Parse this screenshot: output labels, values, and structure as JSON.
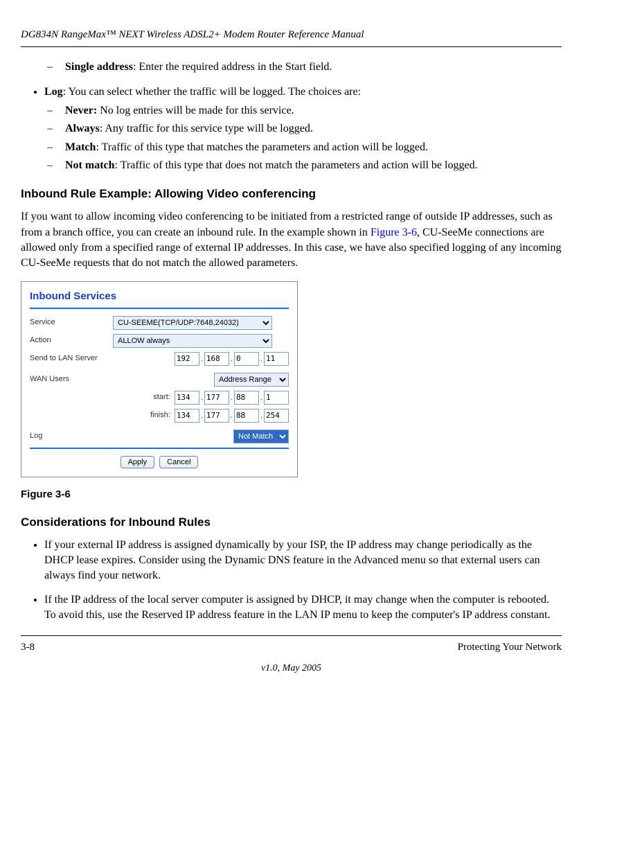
{
  "header": {
    "title": "DG834N RangeMax™ NEXT Wireless ADSL2+ Modem Router Reference Manual"
  },
  "content": {
    "single_address_line": {
      "label": "Single address",
      "text": ": Enter the required address in the Start field."
    },
    "log_intro": {
      "label": "Log",
      "text": ": You can select whether the traffic will be logged. The choices are:"
    },
    "log_items": [
      {
        "label": "Never:",
        "text": " No log entries will be made for this service."
      },
      {
        "label": "Always",
        "text": ": Any traffic for this service type will be logged."
      },
      {
        "label": "Match",
        "text": ": Traffic of this type that matches the parameters and action will be logged."
      },
      {
        "label": "Not match",
        "text": ": Traffic of this type that does not match the parameters and action will be logged."
      }
    ],
    "h_inbound_example": "Inbound Rule Example: Allowing Video conferencing",
    "inbound_paragraph_pre": "If you want to allow incoming video conferencing to be initiated from a restricted range of outside IP addresses, such as from a branch office, you can create an inbound rule. In the example shown in ",
    "figref": "Figure 3-6",
    "inbound_paragraph_post": ", CU-SeeMe connections are allowed only from a specified range of external IP addresses. In this case, we have also specified logging of any incoming CU-SeeMe requests that do not match the allowed parameters.",
    "figure_caption": "Figure 3-6",
    "h_considerations": "Considerations for Inbound Rules",
    "considerations": [
      "If your external IP address is assigned dynamically by your ISP, the IP address may change periodically as the DHCP lease expires. Consider using the Dynamic DNS feature in the Advanced menu so that external users can always find your network.",
      "If the IP address of the local server computer is assigned by DHCP, it may change when the computer is rebooted. To avoid this, use the Reserved IP address feature in the LAN IP menu to keep the computer's IP address constant."
    ]
  },
  "panel": {
    "title": "Inbound Services",
    "labels": {
      "service": "Service",
      "action": "Action",
      "send_to_lan": "Send to LAN Server",
      "wan_users": "WAN Users",
      "start": "start:",
      "finish": "finish:",
      "log": "Log"
    },
    "values": {
      "service_sel": "CU-SEEME(TCP/UDP:7648,24032)",
      "action_sel": "ALLOW always",
      "lan_ip": [
        "192",
        "168",
        "0",
        "11"
      ],
      "wan_users_sel": "Address Range",
      "start_ip": [
        "134",
        "177",
        "88",
        "1"
      ],
      "finish_ip": [
        "134",
        "177",
        "88",
        "254"
      ],
      "log_sel": "Not Match"
    },
    "buttons": {
      "apply": "Apply",
      "cancel": "Cancel"
    }
  },
  "footer": {
    "page": "3-8",
    "section": "Protecting Your Network",
    "version": "v1.0, May 2005"
  }
}
